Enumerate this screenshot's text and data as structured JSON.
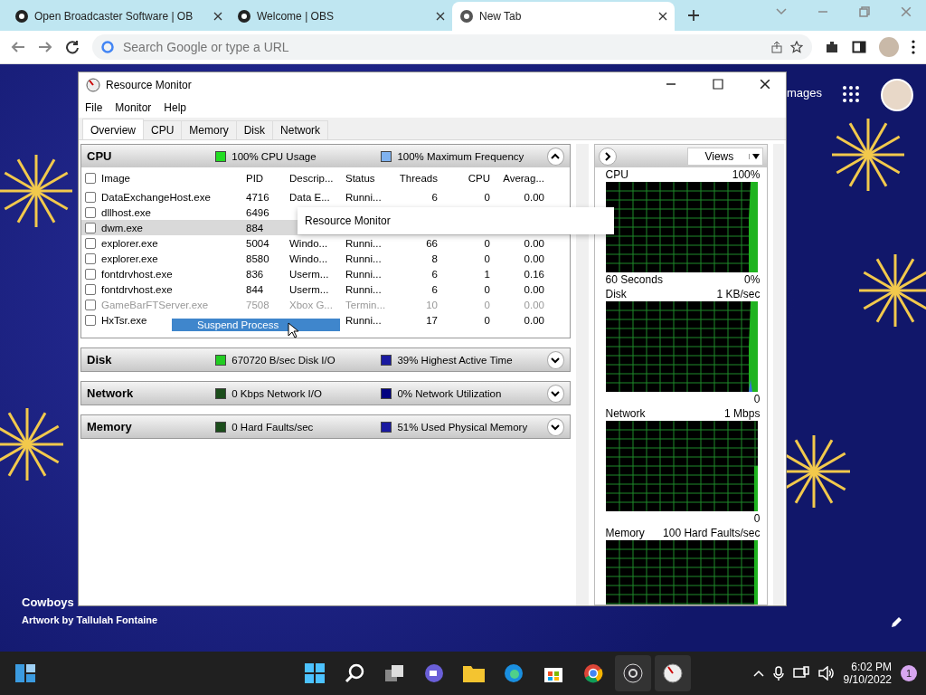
{
  "browser": {
    "tabs": [
      {
        "title": "Open Broadcaster Software | OB",
        "selected": false
      },
      {
        "title": "Welcome | OBS",
        "selected": false
      },
      {
        "title": "New Tab",
        "selected": true
      }
    ],
    "address_bar": {
      "placeholder": "Search Google or type a URL"
    }
  },
  "new_tab_page": {
    "link": "mages"
  },
  "window": {
    "title": "Resource Monitor",
    "menu": [
      "File",
      "Monitor",
      "Help"
    ],
    "tabs": [
      {
        "label": "Overview",
        "selected": true
      },
      {
        "label": "CPU",
        "selected": false
      },
      {
        "label": "Memory",
        "selected": false
      },
      {
        "label": "Disk",
        "selected": false
      },
      {
        "label": "Network",
        "selected": false
      }
    ],
    "sections": [
      {
        "title": "CPU",
        "expanded": true,
        "stats": [
          {
            "text": "100% CPU Usage",
            "color": "#22dd22"
          },
          {
            "text": "100% Maximum Frequency",
            "color": "#7fb2f0"
          }
        ]
      },
      {
        "title": "Disk",
        "expanded": false,
        "stats": [
          {
            "text": "670720 B/sec Disk I/O",
            "color": "#22cc22"
          },
          {
            "text": "39% Highest Active Time",
            "color": "#1a1aa0"
          }
        ]
      },
      {
        "title": "Network",
        "expanded": false,
        "stats": [
          {
            "text": "0 Kbps Network I/O",
            "color": "#1b4d1b"
          },
          {
            "text": "0% Network Utilization",
            "color": "#000080"
          }
        ]
      },
      {
        "title": "Memory",
        "expanded": false,
        "stats": [
          {
            "text": "0 Hard Faults/sec",
            "color": "#1b4d1b"
          },
          {
            "text": "51% Used Physical Memory",
            "color": "#1a1aa0"
          }
        ]
      }
    ],
    "table": {
      "header_checked": false,
      "columns": [
        "Image",
        "PID",
        "Descrip...",
        "Status",
        "Threads",
        "CPU",
        "Averag..."
      ],
      "rows": [
        {
          "image": "DataExchangeHost.exe",
          "pid": "4716",
          "description": "Data E...",
          "status": "Runni...",
          "threads": "6",
          "cpu": "0",
          "average": "0.00",
          "checked": false,
          "selected": false,
          "disabled": false
        },
        {
          "image": "dllhost.exe",
          "pid": "6496",
          "checked": false,
          "selected": false,
          "disabled": false
        },
        {
          "image": "dwm.exe",
          "pid": "884",
          "checked": false,
          "selected": true,
          "disabled": false
        },
        {
          "image": "explorer.exe",
          "pid": "5004",
          "description": "Windo...",
          "status": "Runni...",
          "threads": "66",
          "cpu": "0",
          "average": "0.00",
          "checked": false,
          "selected": false,
          "disabled": false
        },
        {
          "image": "explorer.exe",
          "pid": "8580",
          "description": "Windo...",
          "status": "Runni...",
          "threads": "8",
          "cpu": "0",
          "average": "0.00",
          "checked": false,
          "selected": false,
          "disabled": false
        },
        {
          "image": "fontdrvhost.exe",
          "pid": "836",
          "description": "Userm...",
          "status": "Runni...",
          "threads": "6",
          "cpu": "1",
          "average": "0.16",
          "checked": false,
          "selected": false,
          "disabled": false
        },
        {
          "image": "fontdrvhost.exe",
          "pid": "844",
          "description": "Userm...",
          "status": "Runni...",
          "threads": "6",
          "cpu": "0",
          "average": "0.00",
          "checked": false,
          "selected": false,
          "disabled": false
        },
        {
          "image": "GameBarFTServer.exe",
          "pid": "7508",
          "description": "Xbox G...",
          "status": "Termin...",
          "threads": "10",
          "cpu": "0",
          "average": "0.00",
          "checked": false,
          "selected": false,
          "disabled": true
        },
        {
          "image": "HxTsr.exe",
          "status": "Runni...",
          "threads": "17",
          "cpu": "0",
          "average": "0.00",
          "checked": false,
          "selected": false,
          "disabled": false
        }
      ]
    },
    "tooltip": "Resource Monitor",
    "drag_label": "Suspend Process",
    "views_button": "Views",
    "graphs": [
      {
        "name": "CPU",
        "max": "100%",
        "span": "60 Seconds",
        "min": "0%"
      },
      {
        "name": "Disk",
        "max": "1 KB/sec",
        "min": "0"
      },
      {
        "name": "Network",
        "max": "1 Mbps",
        "min": "0"
      },
      {
        "name": "Memory",
        "max": "100 Hard Faults/sec"
      }
    ]
  },
  "wallpaper": {
    "title": "Cowboys",
    "credit": "Artwork by Tallulah Fontaine"
  },
  "taskbar": {
    "time": "6:02 PM",
    "date": "9/10/2022",
    "notification_count": "1"
  }
}
